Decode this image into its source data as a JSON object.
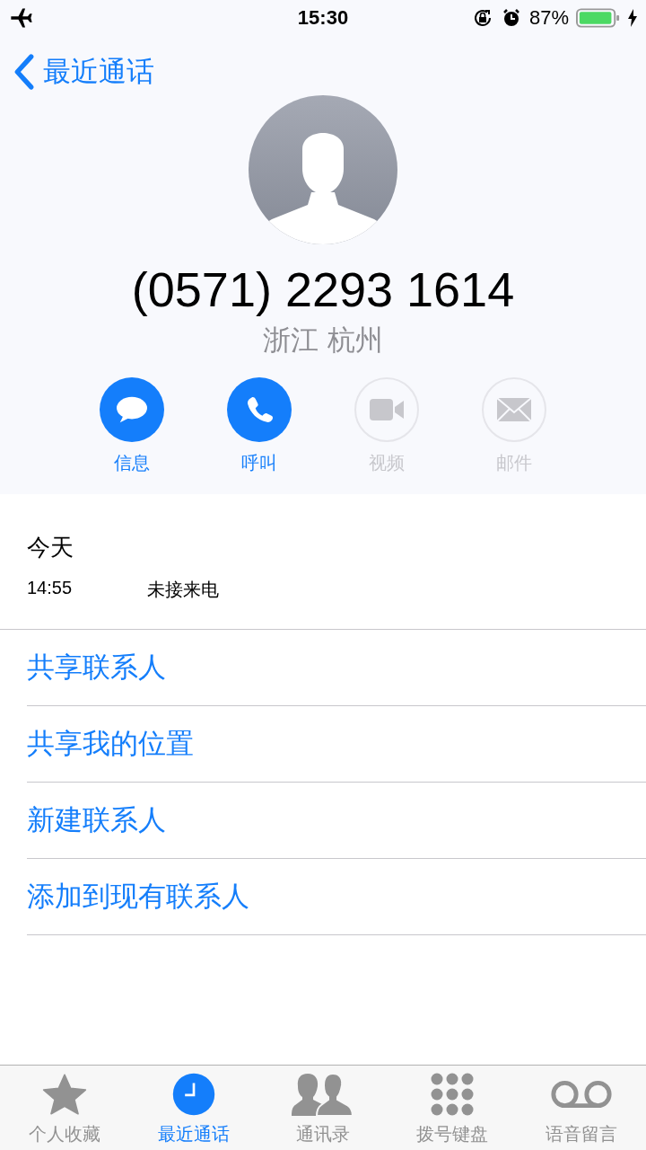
{
  "status_bar": {
    "time": "15:30",
    "battery": "87%"
  },
  "nav": {
    "back": "最近通话"
  },
  "contact": {
    "number": "(0571) 2293 1614",
    "location": "浙江 杭州"
  },
  "actions": [
    {
      "kind": "message",
      "label": "信息",
      "disabled": false
    },
    {
      "kind": "call",
      "label": "呼叫",
      "disabled": false
    },
    {
      "kind": "video",
      "label": "视频",
      "disabled": true
    },
    {
      "kind": "mail",
      "label": "邮件",
      "disabled": true
    }
  ],
  "history": {
    "date": "今天",
    "entries": [
      {
        "time": "14:55",
        "type": "未接来电"
      }
    ]
  },
  "options": [
    "共享联系人",
    "共享我的位置",
    "新建联系人",
    "添加到现有联系人"
  ],
  "tabs": [
    {
      "kind": "favorites",
      "label": "个人收藏",
      "selected": false
    },
    {
      "kind": "recents",
      "label": "最近通话",
      "selected": true
    },
    {
      "kind": "contacts",
      "label": "通讯录",
      "selected": false
    },
    {
      "kind": "keypad",
      "label": "拨号键盘",
      "selected": false
    },
    {
      "kind": "voicemail",
      "label": "语音留言",
      "selected": false
    }
  ]
}
